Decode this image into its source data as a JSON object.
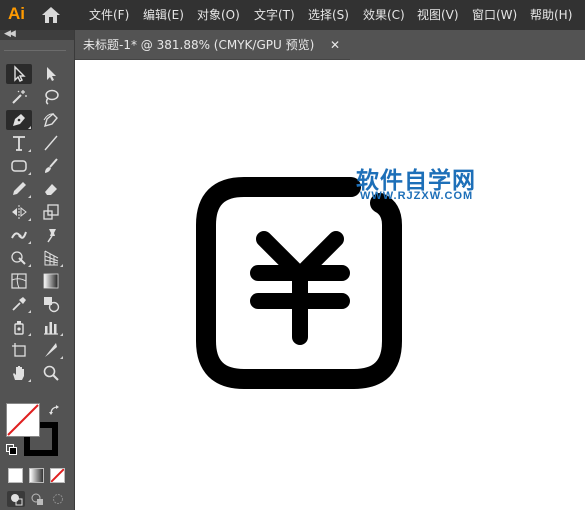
{
  "app": {
    "logo_text": "Ai"
  },
  "menu": [
    "文件(F)",
    "编辑(E)",
    "对象(O)",
    "文字(T)",
    "选择(S)",
    "效果(C)",
    "视图(V)",
    "窗口(W)",
    "帮助(H)"
  ],
  "document_tab": {
    "title": "未标题-1* @ 381.88% (CMYK/GPU 预览)",
    "close_glyph": "✕"
  },
  "watermark": {
    "title": "软件自学网",
    "url": "WWW.RJZXW.COM",
    "color": "#1d6fb8"
  },
  "colors": {
    "menubar": "#323232",
    "panel": "#535353",
    "canvas": "#ffffff",
    "brand_orange": "#ff9a00",
    "artwork": "#000000"
  },
  "tools": [
    "selection-tool",
    "direct-selection-tool",
    "magic-wand-tool",
    "lasso-tool",
    "pen-tool",
    "curvature-tool",
    "type-tool",
    "line-segment-tool",
    "rectangle-tool",
    "paintbrush-tool",
    "shaper-tool",
    "eraser-tool",
    "rotate-tool",
    "scale-tool",
    "width-tool",
    "puppet-warp-tool",
    "shape-builder-tool",
    "perspective-grid-tool",
    "mesh-tool",
    "gradient-tool",
    "eyedropper-tool",
    "blend-tool",
    "symbol-sprayer-tool",
    "column-graph-tool",
    "artboard-tool",
    "slice-tool",
    "hand-tool",
    "zoom-tool"
  ],
  "selected_tool": "pen-tool",
  "fill_stroke": {
    "fill": "none",
    "stroke": "#000000"
  }
}
